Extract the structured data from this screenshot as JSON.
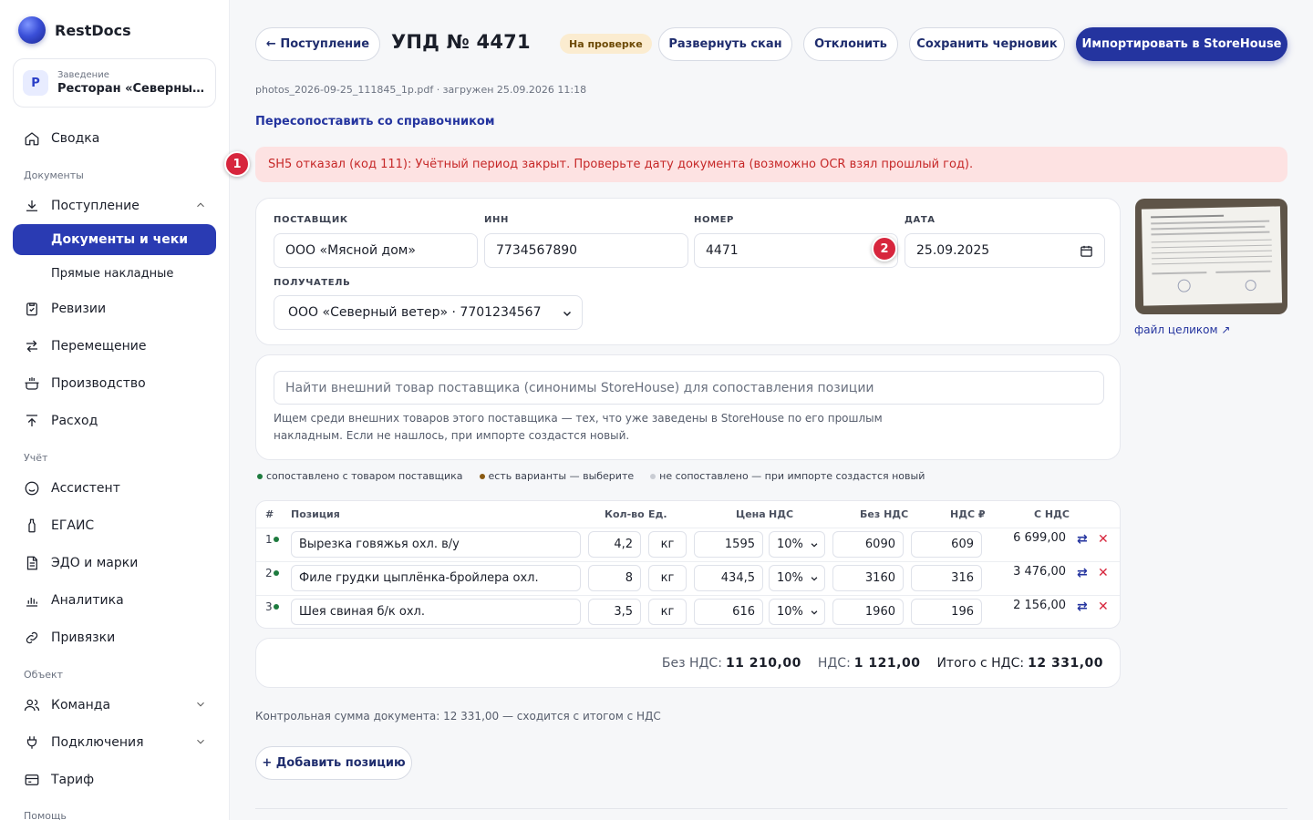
{
  "brand": {
    "name": "RestDocs"
  },
  "venue": {
    "caption": "Заведение",
    "avatar": "Р",
    "name": "Ресторан «Северный ..."
  },
  "sidebar": {
    "summary": "Сводка",
    "section_documents": "Документы",
    "receipts": "Поступление",
    "documents_checks": "Документы и чеки",
    "direct_invoices": "Прямые накладные",
    "revisions": "Ревизии",
    "transfer": "Перемещение",
    "production": "Производство",
    "expense": "Расход",
    "section_accounting": "Учёт",
    "assistant": "Ассистент",
    "egais": "ЕГАИС",
    "edo": "ЭДО и марки",
    "analytics": "Аналитика",
    "bindings": "Привязки",
    "section_object": "Объект",
    "team": "Команда",
    "connections": "Подключения",
    "tariff": "Тариф",
    "section_help": "Помощь"
  },
  "header": {
    "back": "← Поступление",
    "title": "УПД № 4471",
    "status": "На проверке",
    "expand_scan": "Развернуть скан",
    "reject": "Отклонить",
    "save_draft": "Сохранить черновик",
    "import": "Импортировать в StoreHouse"
  },
  "file_meta": "photos_2026-09-25_111845_1p.pdf · загружен 25.09.2026 11:18",
  "remap_link": "Пересопоставить со справочником",
  "alert": {
    "marker": "1",
    "text": "SH5 отказал (код 111): Учётный период закрыт. Проверьте дату документа (возможно OCR взял прошлый год)."
  },
  "form": {
    "supplier_label": "ПОСТАВЩИК",
    "supplier": "ООО «Мясной дом»",
    "inn_label": "ИНН",
    "inn": "7734567890",
    "number_label": "НОМЕР",
    "number": "4471",
    "date_marker": "2",
    "date_label": "ДАТА",
    "date": "25.09.2025",
    "recipient_label": "ПОЛУЧАТЕЛЬ",
    "recipient": "ООО «Северный ветер» · 7701234567"
  },
  "scan": {
    "full_file_link": "файл целиком ↗"
  },
  "search": {
    "placeholder": "Найти внешний товар поставщика (синонимы StoreHouse) для сопоставления позиции",
    "hint": "Ищем среди внешних товаров этого поставщика — тех, что уже заведены в StoreHouse по его прошлым накладным. Если не нашлось, при импорте создастся новый."
  },
  "legend": {
    "matched": "сопоставлено с товаром поставщика",
    "variants": "есть варианты — выберите",
    "unmatched": "не сопоставлено — при импорте создастся новый"
  },
  "colors": {
    "matched": "#1e7b3f",
    "variants": "#8a5a12",
    "unmatched": "#c9ccd3",
    "primary": "#24349f",
    "alert": "#c62828"
  },
  "table": {
    "headers": {
      "num": "#",
      "position": "Позиция",
      "qty": "Кол-во",
      "unit": "Ед.",
      "price": "Цена",
      "vat": "НДС",
      "no_vat": "Без НДС",
      "vat_sum": "НДС ₽",
      "with_vat": "С НДС"
    },
    "rows": [
      {
        "num": "1",
        "name": "Вырезка говяжья охл. в/у",
        "qty": "4,2",
        "unit": "кг",
        "price": "1595",
        "vat": "10%",
        "no_vat": "6090",
        "vat_sum": "609",
        "total": "6 699,00"
      },
      {
        "num": "2",
        "name": "Филе грудки цыплёнка-бройлера охл.",
        "qty": "8",
        "unit": "кг",
        "price": "434,5",
        "vat": "10%",
        "no_vat": "3160",
        "vat_sum": "316",
        "total": "3 476,00"
      },
      {
        "num": "3",
        "name": "Шея свиная б/к охл.",
        "qty": "3,5",
        "unit": "кг",
        "price": "616",
        "vat": "10%",
        "no_vat": "1960",
        "vat_sum": "196",
        "total": "2 156,00"
      }
    ]
  },
  "totals": {
    "no_vat_label": "Без НДС:",
    "no_vat": "11 210,00",
    "vat_label": "НДС:",
    "vat": "1 121,00",
    "total_label": "Итого с НДС:",
    "total": "12 331,00"
  },
  "control_sum": "Контрольная сумма документа: 12 331,00 — сходится с итогом с НДС",
  "add_position": "+ Добавить позицию"
}
